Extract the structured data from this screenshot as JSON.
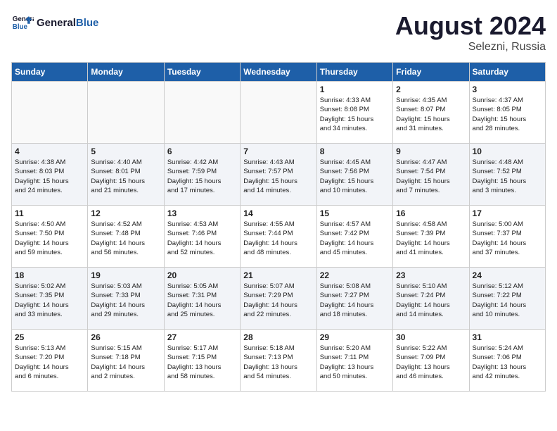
{
  "header": {
    "logo_line1": "General",
    "logo_line2": "Blue",
    "month_year": "August 2024",
    "location": "Selezni, Russia"
  },
  "days_of_week": [
    "Sunday",
    "Monday",
    "Tuesday",
    "Wednesday",
    "Thursday",
    "Friday",
    "Saturday"
  ],
  "weeks": [
    [
      {
        "day": "",
        "info": ""
      },
      {
        "day": "",
        "info": ""
      },
      {
        "day": "",
        "info": ""
      },
      {
        "day": "",
        "info": ""
      },
      {
        "day": "1",
        "info": "Sunrise: 4:33 AM\nSunset: 8:08 PM\nDaylight: 15 hours\nand 34 minutes."
      },
      {
        "day": "2",
        "info": "Sunrise: 4:35 AM\nSunset: 8:07 PM\nDaylight: 15 hours\nand 31 minutes."
      },
      {
        "day": "3",
        "info": "Sunrise: 4:37 AM\nSunset: 8:05 PM\nDaylight: 15 hours\nand 28 minutes."
      }
    ],
    [
      {
        "day": "4",
        "info": "Sunrise: 4:38 AM\nSunset: 8:03 PM\nDaylight: 15 hours\nand 24 minutes."
      },
      {
        "day": "5",
        "info": "Sunrise: 4:40 AM\nSunset: 8:01 PM\nDaylight: 15 hours\nand 21 minutes."
      },
      {
        "day": "6",
        "info": "Sunrise: 4:42 AM\nSunset: 7:59 PM\nDaylight: 15 hours\nand 17 minutes."
      },
      {
        "day": "7",
        "info": "Sunrise: 4:43 AM\nSunset: 7:57 PM\nDaylight: 15 hours\nand 14 minutes."
      },
      {
        "day": "8",
        "info": "Sunrise: 4:45 AM\nSunset: 7:56 PM\nDaylight: 15 hours\nand 10 minutes."
      },
      {
        "day": "9",
        "info": "Sunrise: 4:47 AM\nSunset: 7:54 PM\nDaylight: 15 hours\nand 7 minutes."
      },
      {
        "day": "10",
        "info": "Sunrise: 4:48 AM\nSunset: 7:52 PM\nDaylight: 15 hours\nand 3 minutes."
      }
    ],
    [
      {
        "day": "11",
        "info": "Sunrise: 4:50 AM\nSunset: 7:50 PM\nDaylight: 14 hours\nand 59 minutes."
      },
      {
        "day": "12",
        "info": "Sunrise: 4:52 AM\nSunset: 7:48 PM\nDaylight: 14 hours\nand 56 minutes."
      },
      {
        "day": "13",
        "info": "Sunrise: 4:53 AM\nSunset: 7:46 PM\nDaylight: 14 hours\nand 52 minutes."
      },
      {
        "day": "14",
        "info": "Sunrise: 4:55 AM\nSunset: 7:44 PM\nDaylight: 14 hours\nand 48 minutes."
      },
      {
        "day": "15",
        "info": "Sunrise: 4:57 AM\nSunset: 7:42 PM\nDaylight: 14 hours\nand 45 minutes."
      },
      {
        "day": "16",
        "info": "Sunrise: 4:58 AM\nSunset: 7:39 PM\nDaylight: 14 hours\nand 41 minutes."
      },
      {
        "day": "17",
        "info": "Sunrise: 5:00 AM\nSunset: 7:37 PM\nDaylight: 14 hours\nand 37 minutes."
      }
    ],
    [
      {
        "day": "18",
        "info": "Sunrise: 5:02 AM\nSunset: 7:35 PM\nDaylight: 14 hours\nand 33 minutes."
      },
      {
        "day": "19",
        "info": "Sunrise: 5:03 AM\nSunset: 7:33 PM\nDaylight: 14 hours\nand 29 minutes."
      },
      {
        "day": "20",
        "info": "Sunrise: 5:05 AM\nSunset: 7:31 PM\nDaylight: 14 hours\nand 25 minutes."
      },
      {
        "day": "21",
        "info": "Sunrise: 5:07 AM\nSunset: 7:29 PM\nDaylight: 14 hours\nand 22 minutes."
      },
      {
        "day": "22",
        "info": "Sunrise: 5:08 AM\nSunset: 7:27 PM\nDaylight: 14 hours\nand 18 minutes."
      },
      {
        "day": "23",
        "info": "Sunrise: 5:10 AM\nSunset: 7:24 PM\nDaylight: 14 hours\nand 14 minutes."
      },
      {
        "day": "24",
        "info": "Sunrise: 5:12 AM\nSunset: 7:22 PM\nDaylight: 14 hours\nand 10 minutes."
      }
    ],
    [
      {
        "day": "25",
        "info": "Sunrise: 5:13 AM\nSunset: 7:20 PM\nDaylight: 14 hours\nand 6 minutes."
      },
      {
        "day": "26",
        "info": "Sunrise: 5:15 AM\nSunset: 7:18 PM\nDaylight: 14 hours\nand 2 minutes."
      },
      {
        "day": "27",
        "info": "Sunrise: 5:17 AM\nSunset: 7:15 PM\nDaylight: 13 hours\nand 58 minutes."
      },
      {
        "day": "28",
        "info": "Sunrise: 5:18 AM\nSunset: 7:13 PM\nDaylight: 13 hours\nand 54 minutes."
      },
      {
        "day": "29",
        "info": "Sunrise: 5:20 AM\nSunset: 7:11 PM\nDaylight: 13 hours\nand 50 minutes."
      },
      {
        "day": "30",
        "info": "Sunrise: 5:22 AM\nSunset: 7:09 PM\nDaylight: 13 hours\nand 46 minutes."
      },
      {
        "day": "31",
        "info": "Sunrise: 5:24 AM\nSunset: 7:06 PM\nDaylight: 13 hours\nand 42 minutes."
      }
    ]
  ]
}
